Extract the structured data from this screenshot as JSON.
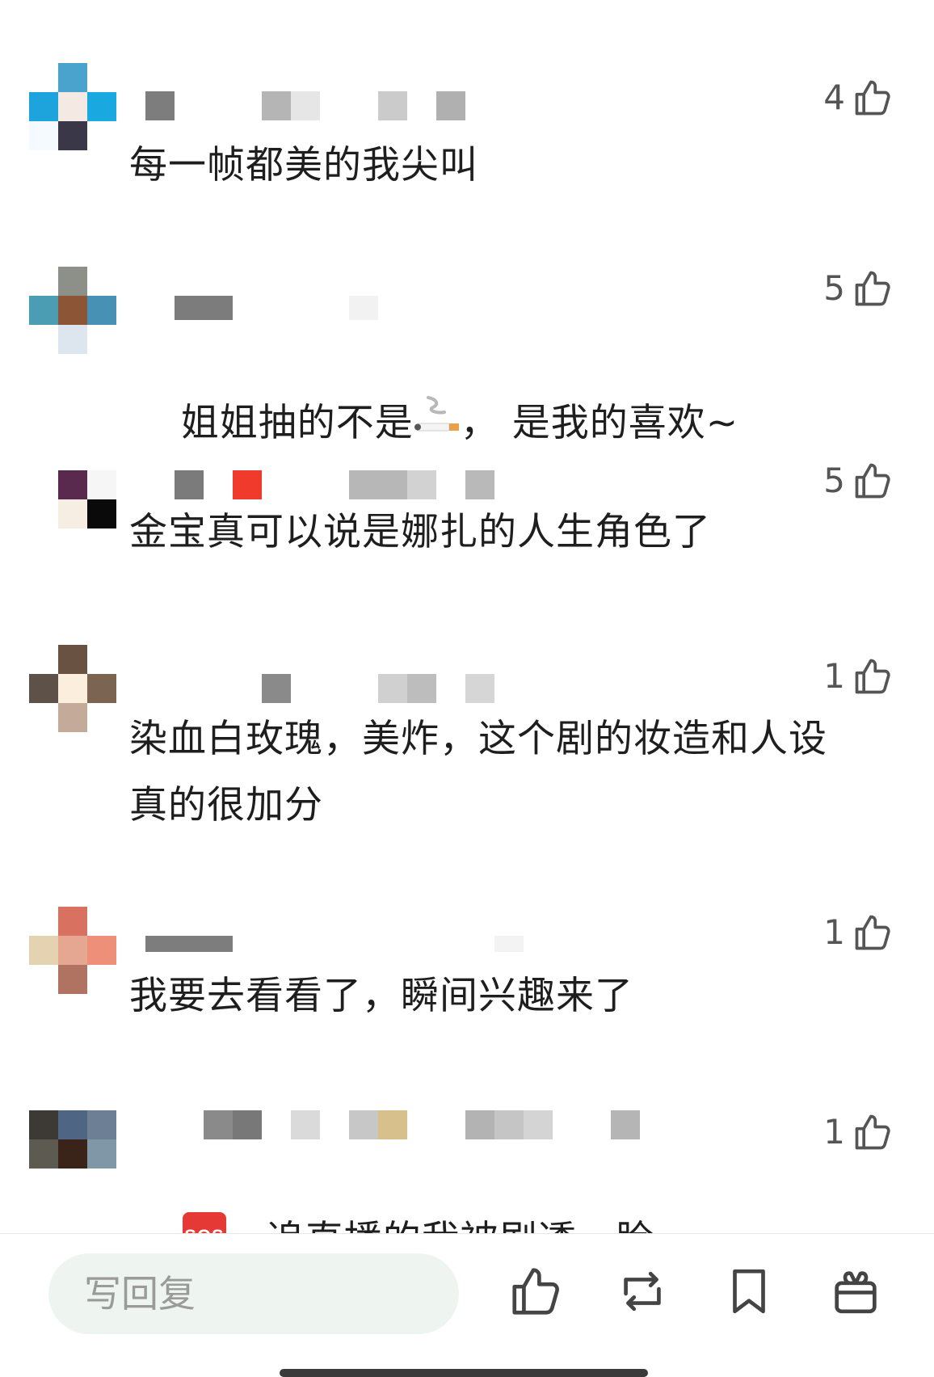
{
  "comments": [
    {
      "text": "每一帧都美的我尖叫",
      "likes": "4"
    },
    {
      "text": "姐姐抽的不是",
      "text_after": "， 是我的喜欢~",
      "likes": "5"
    },
    {
      "text": "金宝真可以说是娜扎的人生角色了",
      "likes": "5"
    },
    {
      "text": "染血白玫瑰，美炸，这个剧的妆造和人设\n真的很加分",
      "likes": "1"
    },
    {
      "text": "我要去看看了，瞬间兴趣来了",
      "likes": "1"
    },
    {
      "text_after": "，追直播的我被剧透一脸",
      "emoji_label": "SOS",
      "likes": "1"
    }
  ],
  "bottom_bar": {
    "reply_placeholder": "写回复",
    "icons": [
      "thumbs-up-icon",
      "repost-icon",
      "bookmark-icon",
      "gift-icon"
    ]
  },
  "colors": {
    "text": "#1e1e1e",
    "like_count": "#555555",
    "reply_bg": "#eef5f0",
    "sos_red": "#e53935"
  }
}
